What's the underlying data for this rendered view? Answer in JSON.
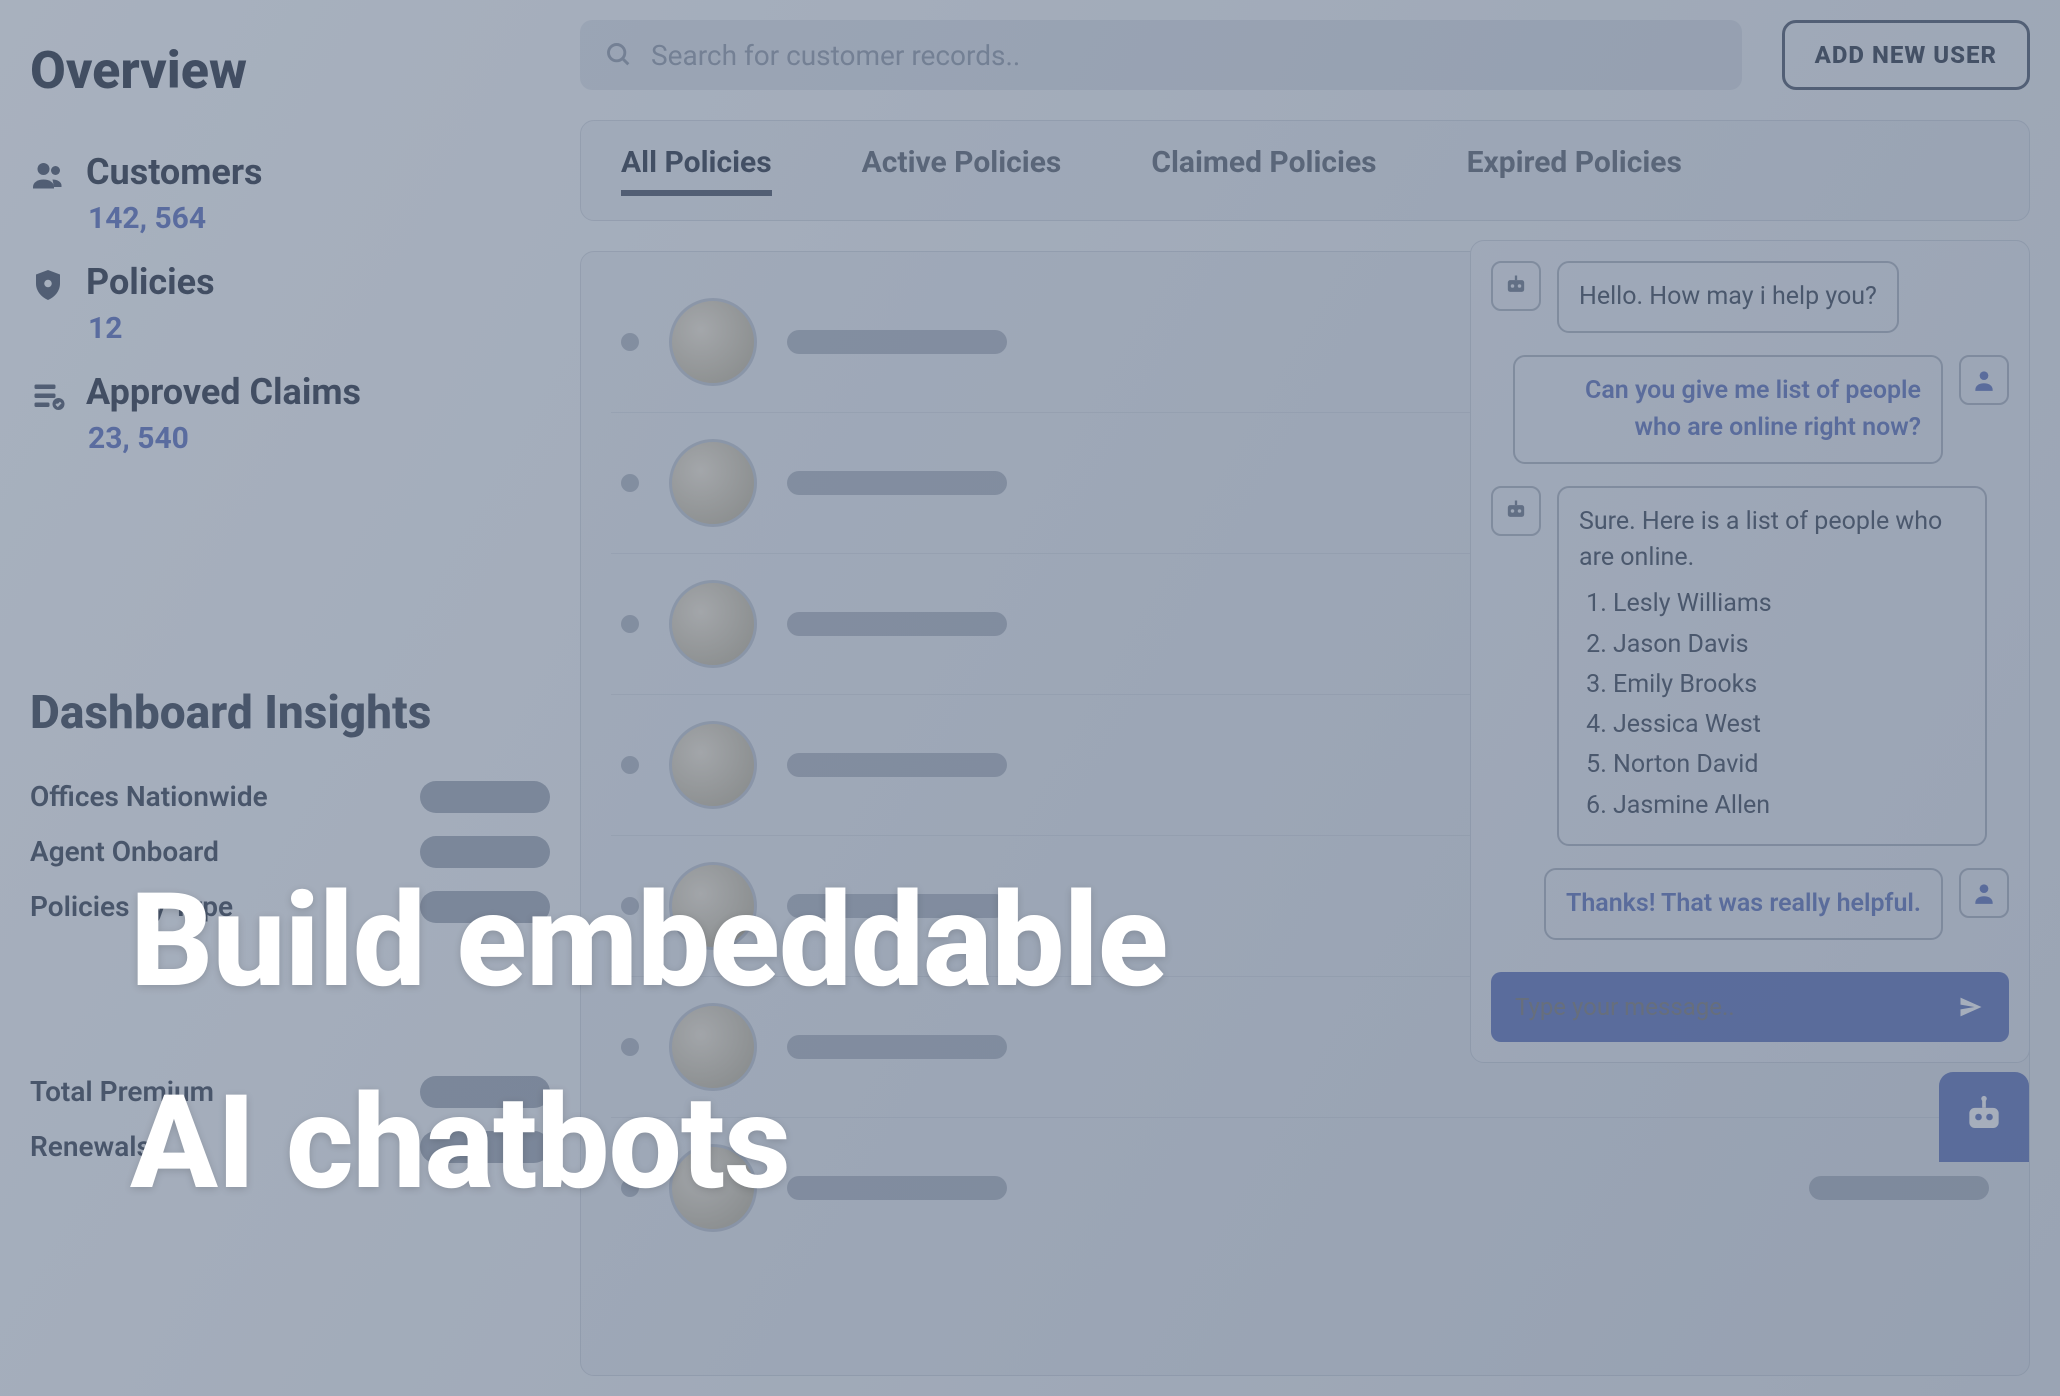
{
  "sidebar": {
    "title": "Overview",
    "stats": [
      {
        "label": "Customers",
        "value": "142, 564",
        "icon": "users-icon"
      },
      {
        "label": "Policies",
        "value": "12",
        "icon": "shield-icon"
      },
      {
        "label": "Approved Claims",
        "value": "23, 540",
        "icon": "checklist-icon"
      }
    ],
    "insights_title": "Dashboard Insights",
    "insights": [
      "Offices Nationwide",
      "Agent Onboard",
      "Policies by Type",
      "Total Premium",
      "Renewals"
    ]
  },
  "topbar": {
    "search_placeholder": "Search for customer records..",
    "add_user_label": "ADD NEW USER"
  },
  "tabs": [
    "All Policies",
    "Active Policies",
    "Claimed Policies",
    "Expired Policies"
  ],
  "active_tab_index": 0,
  "chat": {
    "messages": [
      {
        "from": "bot",
        "text": "Hello. How may i help you?"
      },
      {
        "from": "user",
        "text": "Can you give me list of people who are online right now?"
      },
      {
        "from": "bot",
        "text": "Sure. Here is a list of people who are online.",
        "list": [
          "Lesly Williams",
          "Jason Davis",
          "Emily Brooks",
          "Jessica West",
          "Norton David",
          "Jasmine Allen"
        ]
      },
      {
        "from": "user",
        "text": "Thanks! That was really helpful."
      }
    ],
    "compose_placeholder": "Type your message.."
  },
  "hero": {
    "line1": "Build embeddable",
    "line2": "AI chatbots"
  }
}
